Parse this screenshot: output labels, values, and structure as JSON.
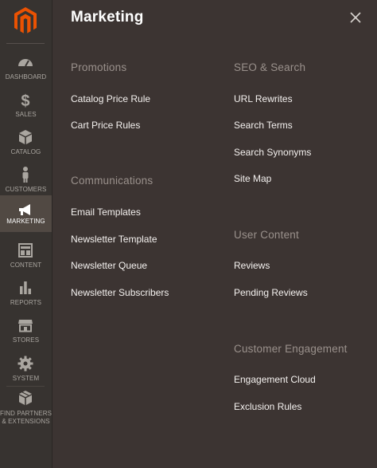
{
  "colors": {
    "sidebar_bg": "#373330",
    "sidebar_active": "#514943",
    "panel_bg": "#3c3432",
    "logo_orange": "#eb5202",
    "group_title": "#9a918c",
    "link_text": "#f4f1ef"
  },
  "sidebar": {
    "logo_icon": "magento-logo-icon",
    "items": [
      {
        "label": "DASHBOARD",
        "icon": "gauge-icon"
      },
      {
        "label": "SALES",
        "icon": "dollar-icon"
      },
      {
        "label": "CATALOG",
        "icon": "box-icon"
      },
      {
        "label": "CUSTOMERS",
        "icon": "person-icon"
      },
      {
        "label": "MARKETING",
        "icon": "megaphone-icon",
        "active": true
      },
      {
        "label": "CONTENT",
        "icon": "layout-icon"
      },
      {
        "label": "REPORTS",
        "icon": "bar-chart-icon"
      },
      {
        "label": "STORES",
        "icon": "storefront-icon"
      },
      {
        "label": "SYSTEM",
        "icon": "gear-icon"
      },
      {
        "label": "FIND PARTNERS",
        "label2": "& EXTENSIONS",
        "icon": "package-icon"
      }
    ]
  },
  "panel": {
    "title": "Marketing",
    "close_icon": "close-icon",
    "groups": {
      "promotions": {
        "title": "Promotions",
        "links": [
          "Catalog Price Rule",
          "Cart Price Rules"
        ]
      },
      "communications": {
        "title": "Communications",
        "links": [
          "Email Templates",
          "Newsletter Template",
          "Newsletter Queue",
          "Newsletter Subscribers"
        ]
      },
      "seo": {
        "title": "SEO & Search",
        "links": [
          "URL Rewrites",
          "Search Terms",
          "Search Synonyms",
          "Site Map"
        ]
      },
      "user_content": {
        "title": "User Content",
        "links": [
          "Reviews",
          "Pending Reviews"
        ]
      },
      "engagement": {
        "title": "Customer Engagement",
        "links": [
          "Engagement Cloud",
          "Exclusion Rules"
        ]
      }
    }
  }
}
